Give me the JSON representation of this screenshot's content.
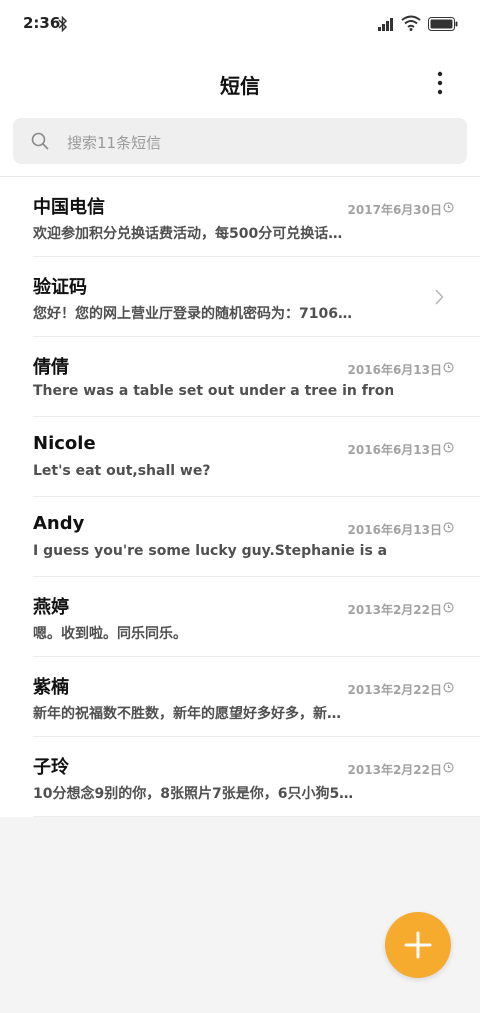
{
  "status_bar": {
    "time": "2:36",
    "icons": [
      "bluetooth-icon",
      "signal-icon",
      "wifi-icon",
      "battery-icon"
    ]
  },
  "header": {
    "title": "短信",
    "menu_icon": "more-vert-icon"
  },
  "search": {
    "placeholder": "搜索11条短信",
    "icon": "search-icon"
  },
  "messages": [
    {
      "name": "中国电信",
      "date": "2017年6月30日",
      "preview": "欢迎参加积分兑换话费活动，每500分可兑换话…",
      "trailing": "clock-icon"
    },
    {
      "name": "验证码",
      "date": "",
      "preview": "您好！您的网上营业厅登录的随机密码为：7106…",
      "trailing": "chevron-right-icon"
    },
    {
      "name": "倩倩",
      "date": "2016年6月13日",
      "preview": "There was a table set out under a tree in front o…",
      "trailing": "clock-icon"
    },
    {
      "name": "Nicole",
      "date": "2016年6月13日",
      "preview": "Let's eat out,shall we?",
      "trailing": "clock-icon"
    },
    {
      "name": "Andy",
      "date": "2016年6月13日",
      "preview": "I guess you're some lucky guy.Stephanie is a nic…",
      "trailing": "clock-icon"
    },
    {
      "name": "燕婷",
      "date": "2013年2月22日",
      "preview": "嗯。收到啦。同乐同乐。",
      "trailing": "clock-icon"
    },
    {
      "name": "紫楠",
      "date": "2013年2月22日",
      "preview": "新年的祝福数不胜数，新年的愿望好多好多，新…",
      "trailing": "clock-icon"
    },
    {
      "name": "子玲",
      "date": "2013年2月22日",
      "preview": "10分想念9别的你，8张照片7张是你，6只小狗5…",
      "trailing": "clock-icon"
    }
  ],
  "fab": {
    "icon": "plus-icon"
  },
  "colors": {
    "accent": "#f6aa2e",
    "background": "#f4f4f4"
  }
}
